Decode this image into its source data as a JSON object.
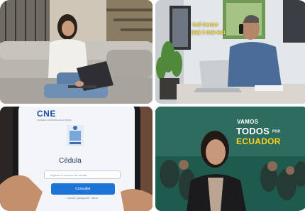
{
  "tiles": {
    "call_center": {
      "label": "Call Center",
      "phone": "(02) 3 815-641"
    },
    "cedula_app": {
      "logo": "CNE",
      "logo_subtitle": "CONSEJO NACIONAL ELECTORAL",
      "title": "Cédula",
      "input_placeholder": "Ingresa tu número de cédula",
      "button_label": "Consultar",
      "footer_text": "...carnet, pasaporte, otros"
    },
    "campaign": {
      "line1": "VAMOS",
      "line2": "TODOS",
      "line2_small": "POR",
      "line3": "ECUADOR"
    }
  },
  "colors": {
    "cne_blue": "#1d4fa8",
    "button_blue": "#1d73d6",
    "callcenter_yellow": "#ffe04a",
    "campaign_yellow": "#ffd21c"
  }
}
